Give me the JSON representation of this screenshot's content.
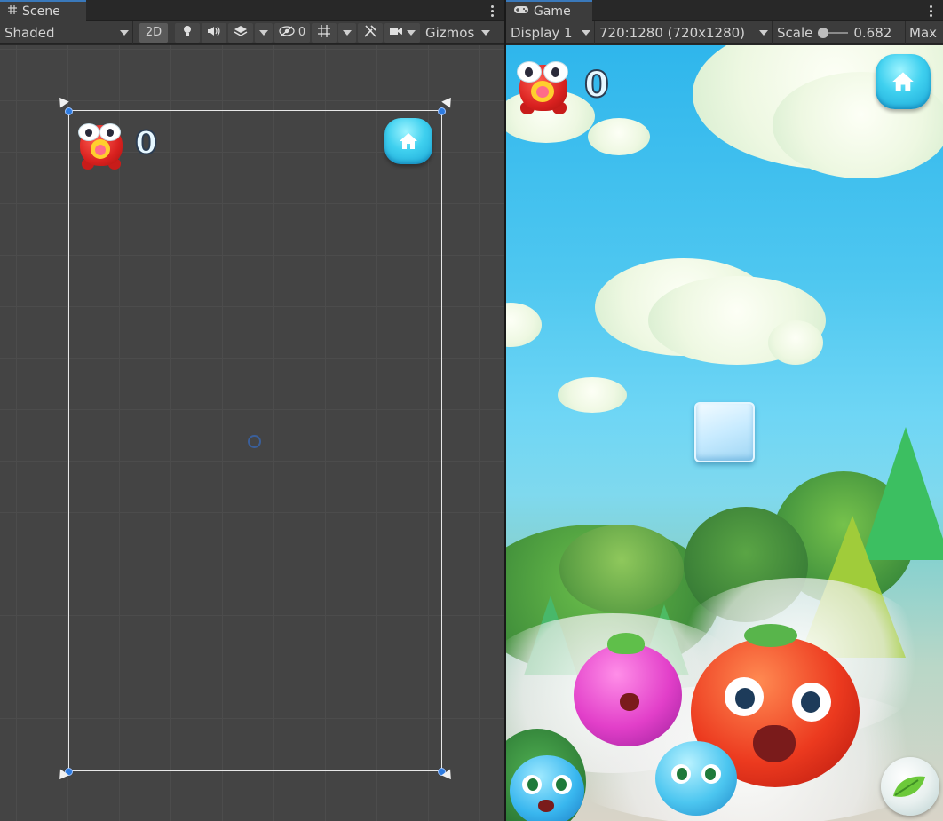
{
  "scene": {
    "tab_label": "Scene",
    "tab_icon": "grid-icon",
    "shading_mode": "Shaded",
    "mode_2d_label": "2D",
    "hidden_count": "0",
    "gizmos_label": "Gizmos",
    "score_value": "0"
  },
  "game": {
    "tab_label": "Game",
    "tab_icon": "gamepad-icon",
    "display": "Display 1",
    "resolution": "720:1280 (720x1280)",
    "scale_label": "Scale",
    "scale_value": "0.682",
    "maximize_label": "Max",
    "score_value": "0"
  },
  "colors": {
    "accent_tab": "#3a79bb",
    "panel_bg": "#282828",
    "toolbar_bg": "#3c3c3c",
    "scene_bg": "#444444",
    "sky": "#2fb6ec",
    "handle_blue": "#2d7be0"
  }
}
